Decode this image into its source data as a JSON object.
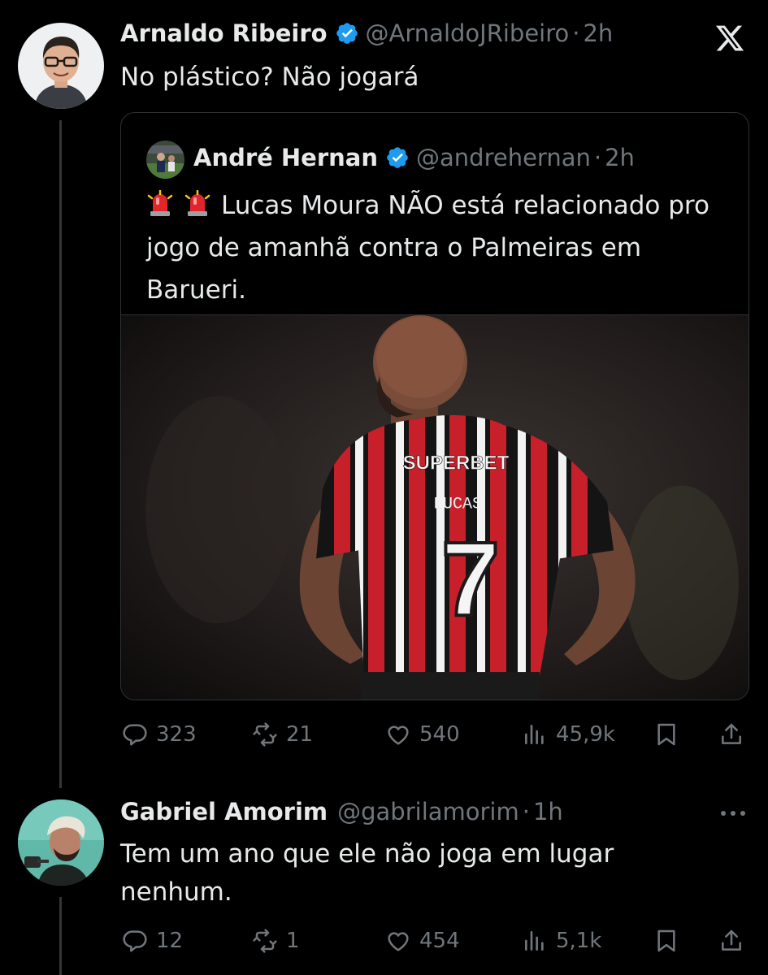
{
  "post": {
    "author_name": "Arnaldo Ribeiro",
    "author_handle": "@ArnaldoJRibeiro",
    "time": "2h",
    "text": "No plástico? Não jogará"
  },
  "quote": {
    "author_name": "André Hernan",
    "author_handle": "@andrehernan",
    "time": "2h",
    "text": "Lucas Moura NÃO está relacionado pro jogo de amanhã contra o Palmeiras em Barueri.",
    "emoji": [
      "police-car-light",
      "police-car-light"
    ],
    "image": {
      "jersey_sponsor": "SUPERBET",
      "jersey_name": "LUCAS",
      "jersey_number": "7"
    }
  },
  "post_actions": {
    "replies": "323",
    "reposts": "21",
    "likes": "540",
    "views": "45,9k"
  },
  "reply": {
    "author_name": "Gabriel Amorim",
    "author_handle": "@gabrilamorim",
    "time": "1h",
    "text": "Tem um ano que ele não joga em lugar nenhum."
  },
  "reply_actions": {
    "replies": "12",
    "reposts": "1",
    "likes": "454",
    "views": "5,1k"
  },
  "separator": "·",
  "colors": {
    "background": "#000000",
    "text_primary": "#e7e9ea",
    "text_secondary": "#71767b",
    "verified": "#1d9bf0",
    "border": "#2f3336"
  }
}
